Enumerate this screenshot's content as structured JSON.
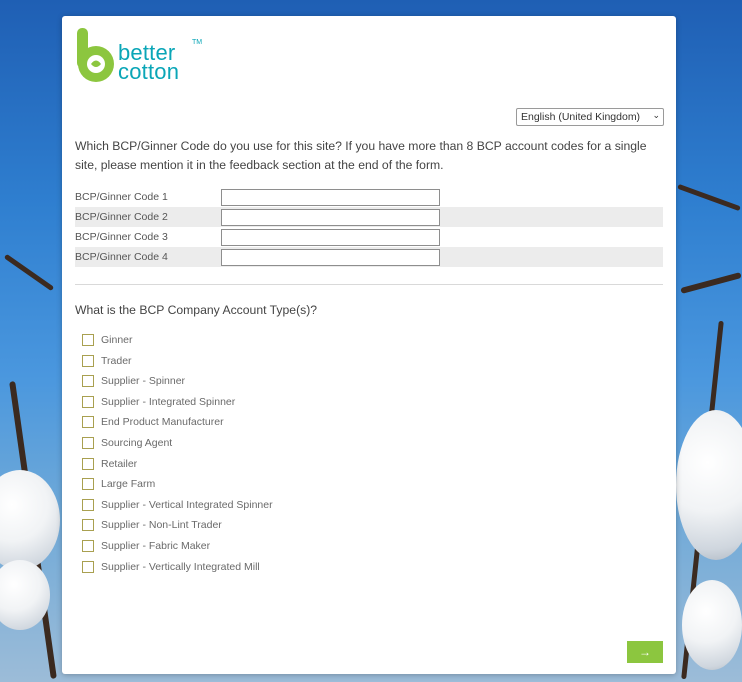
{
  "brand": {
    "logo_line1": "better",
    "logo_line2": "cotton",
    "logo_mark": "TM"
  },
  "language": {
    "selected": "English (United Kingdom)"
  },
  "section1": {
    "question": "Which BCP/Ginner Code do you use for this site? If you have more than 8 BCP account codes for a single site, please mention it in the feedback section at the end of the form.",
    "rows": [
      {
        "label": "BCP/Ginner Code 1",
        "value": ""
      },
      {
        "label": "BCP/Ginner Code 2",
        "value": ""
      },
      {
        "label": "BCP/Ginner Code 3",
        "value": ""
      },
      {
        "label": "BCP/Ginner Code 4",
        "value": ""
      }
    ]
  },
  "section2": {
    "question": "What is the BCP Company Account Type(s)?",
    "options": [
      "Ginner",
      "Trader",
      "Supplier - Spinner",
      "Supplier - Integrated Spinner",
      "End Product Manufacturer",
      "Sourcing Agent",
      "Retailer",
      "Large Farm",
      "Supplier - Vertical Integrated Spinner",
      "Supplier - Non-Lint Trader",
      "Supplier - Fabric Maker",
      "Supplier - Vertically Integrated Mill"
    ]
  },
  "navigation": {
    "next_icon": "→"
  },
  "colors": {
    "brand_teal": "#0aa6b7",
    "brand_green": "#8cc63f"
  }
}
